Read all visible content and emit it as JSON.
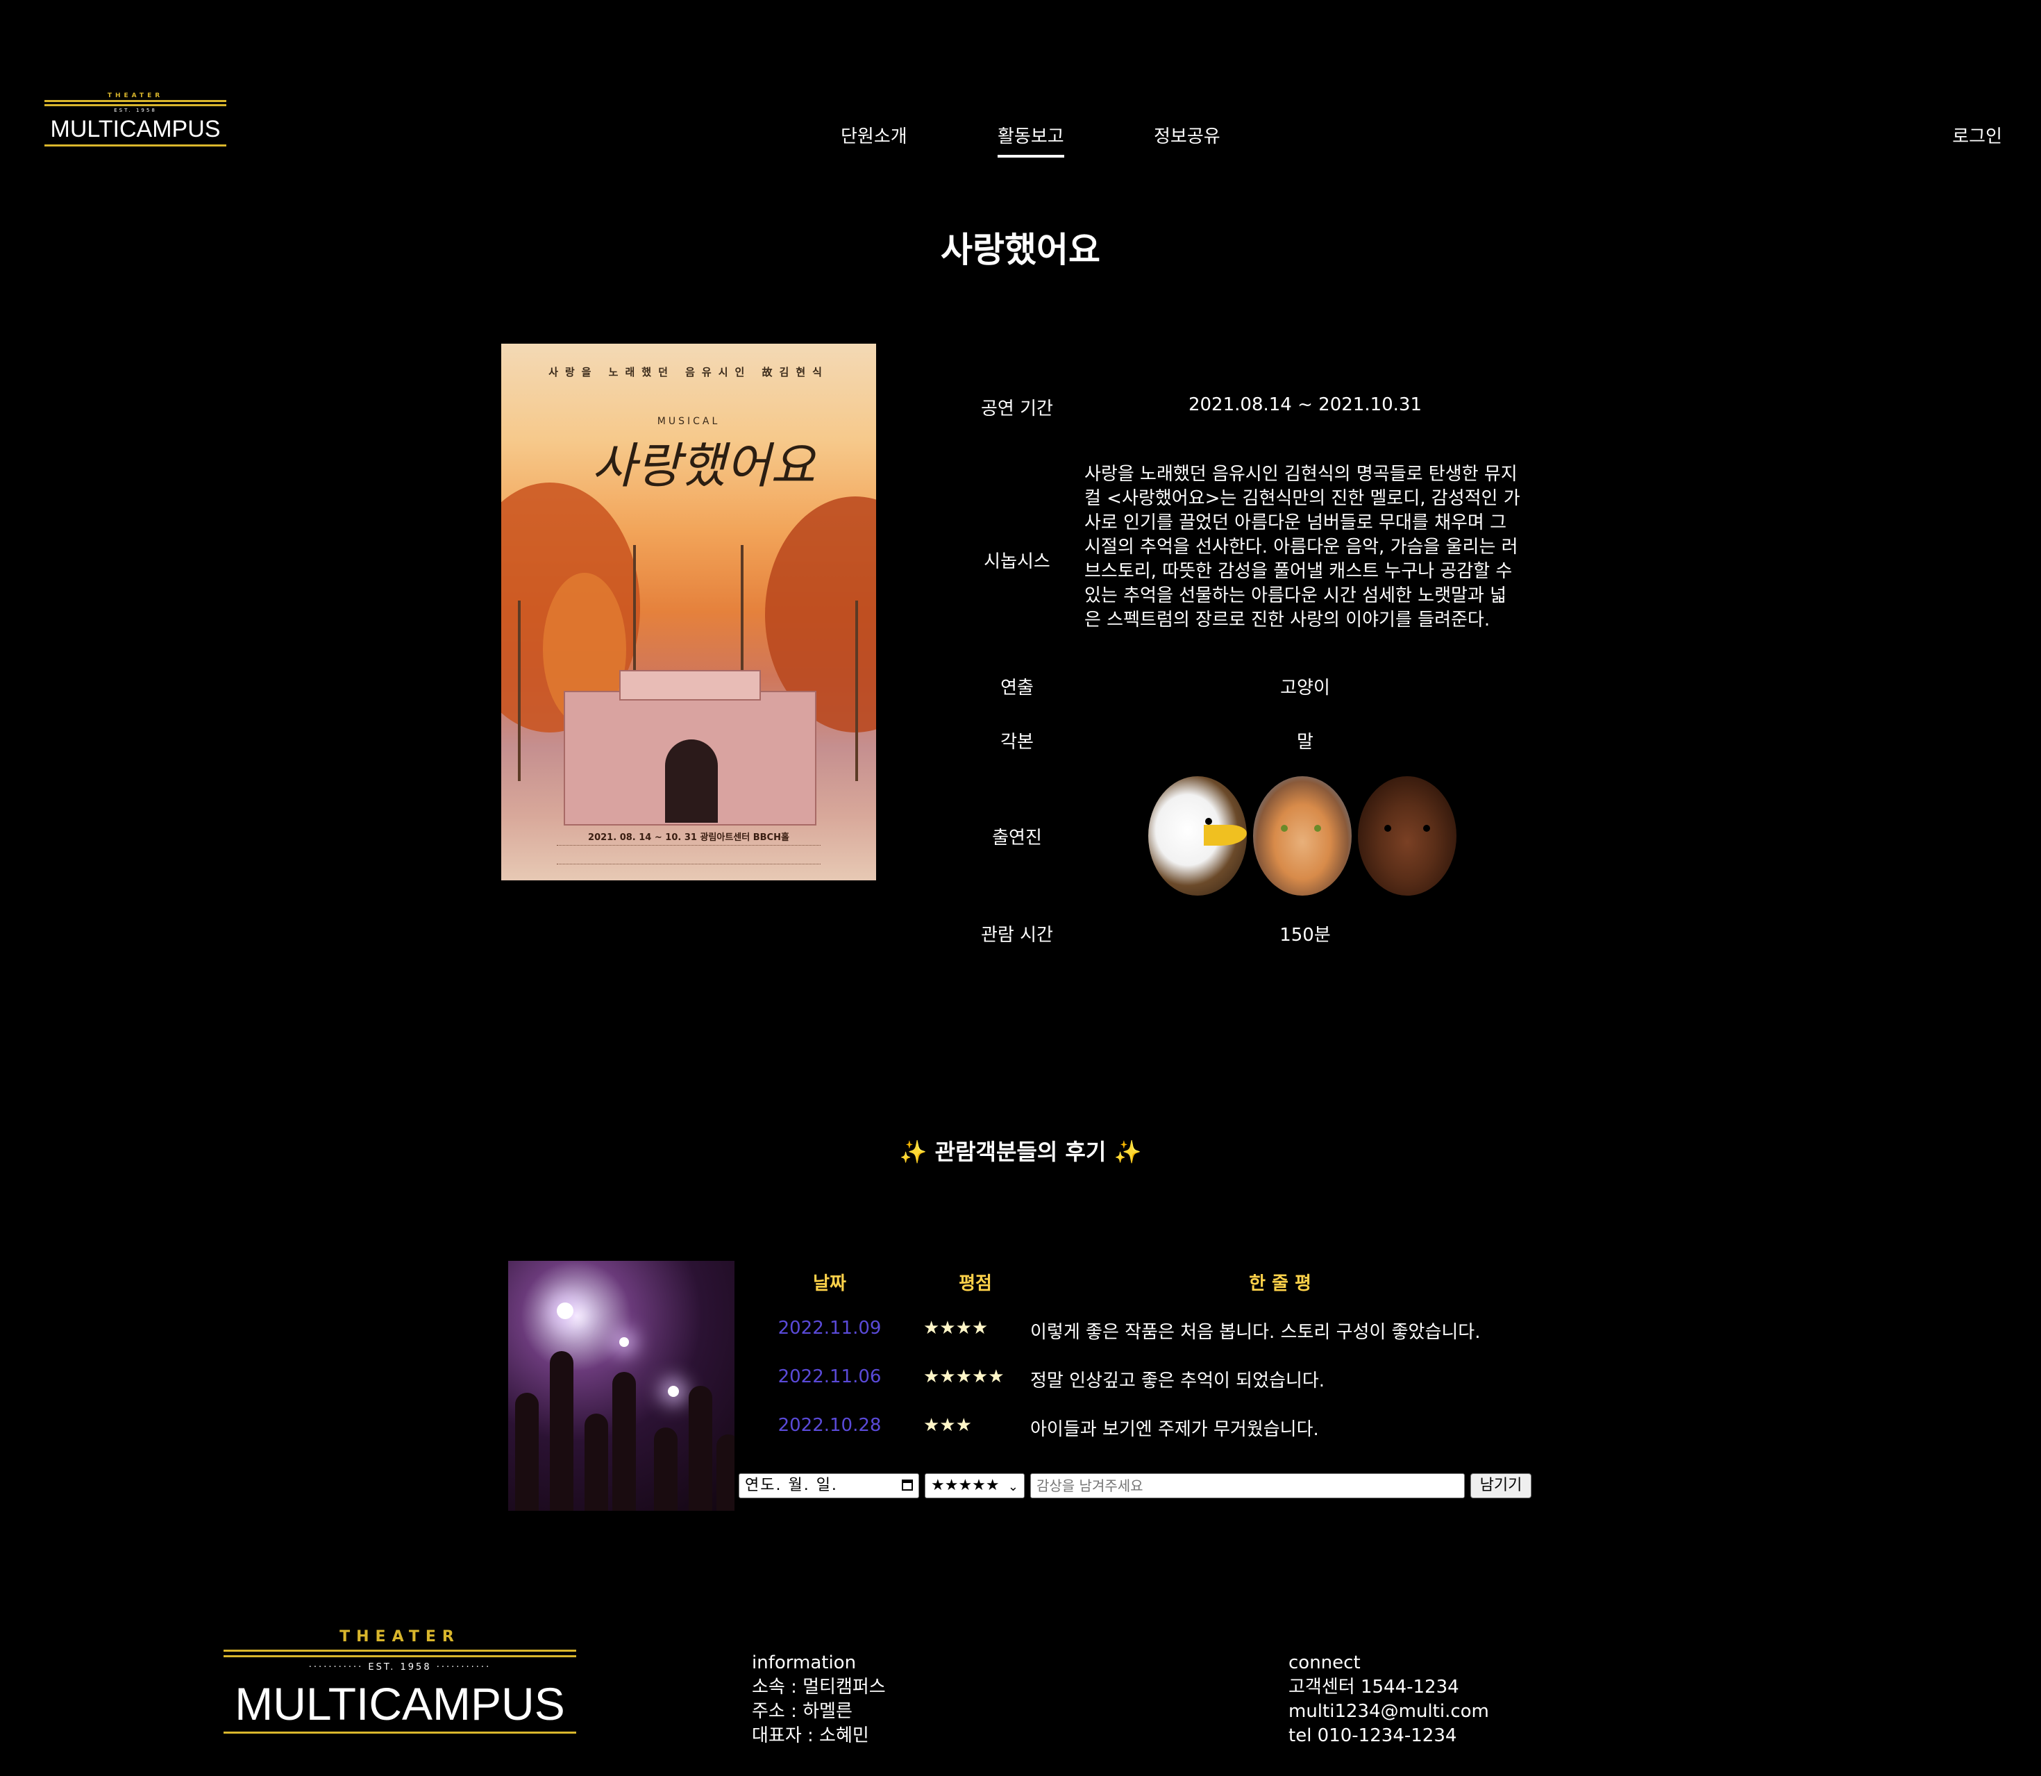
{
  "header": {
    "logo": {
      "theater": "THEATER",
      "est": "EST. 1958",
      "name": "MULTICAMPUS"
    },
    "nav": [
      {
        "label": "단원소개",
        "active": false
      },
      {
        "label": "활동보고",
        "active": true
      },
      {
        "label": "정보공유",
        "active": false
      }
    ],
    "login": "로그인"
  },
  "show": {
    "title": "사랑했어요",
    "poster": {
      "tagline": "사랑을 노래했던 음유시인 故김현식",
      "musical": "MUSICAL",
      "title": "사랑했어요",
      "dates": "2021. 08. 14 ~ 10. 31 광림아트센터 BBCH홀"
    },
    "details": {
      "period_label": "공연 기간",
      "period": "2021.08.14 ~ 2021.10.31",
      "synopsis_label": "시놉시스",
      "synopsis": "사랑을 노래했던 음유시인 김현식의 명곡들로 탄생한 뮤지컬 <사랑했어요>는 김현식만의 진한 멜로디, 감성적인 가사로 인기를 끌었던 아름다운 넘버들로 무대를 채우며 그 시절의 추억을 선사한다. 아름다운 음악, 가슴을 울리는 러브스토리, 따뜻한 감성을 풀어낼 캐스트 누구나 공감할 수 있는 추억을 선물하는 아름다운 시간 섬세한 노랫말과 넓은 스펙트럼의 장르로 진한 사랑의 이야기를 들려준다.",
      "director_label": "연출",
      "director": "고양이",
      "writer_label": "각본",
      "writer": "말",
      "cast_label": "출연진",
      "cast_icons": [
        "eagle-photo",
        "cat-photo",
        "cow-photo"
      ],
      "runtime_label": "관람 시간",
      "runtime": "150분"
    }
  },
  "reviews": {
    "heading": "✨ 관람객분들의 후기 ✨",
    "columns": {
      "date": "날짜",
      "rating": "평점",
      "comment": "한 줄 평"
    },
    "rows": [
      {
        "date": "2022.11.09",
        "stars": "★★★★",
        "text": "이렇게 좋은 작품은 처음 봅니다. 스토리 구성이 좋았습니다."
      },
      {
        "date": "2022.11.06",
        "stars": "★★★★★",
        "text": "정말 인상깊고 좋은 추억이 되었습니다."
      },
      {
        "date": "2022.10.28",
        "stars": "★★★",
        "text": "아이들과 보기엔 주제가 무거웠습니다."
      }
    ],
    "form": {
      "date_placeholder": "연도. 월. 일.",
      "rating_selected": "★★★★★",
      "comment_placeholder": "감상을 남겨주세요",
      "submit": "남기기"
    },
    "date_color": "#5a4ad8",
    "header_color": "#ffd24a"
  },
  "footer": {
    "logo": {
      "theater": "THEATER",
      "est": "EST. 1958",
      "name": "MULTICAMPUS"
    },
    "information": {
      "title": "information",
      "lines": [
        "소속 : 멀티캠퍼스",
        "주소 : 하멜른",
        "대표자 : 소혜민"
      ]
    },
    "connect": {
      "title": "connect",
      "lines": [
        "고객센터 1544-1234",
        "multi1234@multi.com",
        "tel 010-1234-1234"
      ]
    }
  },
  "colors": {
    "background": "#000000",
    "accent_gold": "#d9b62c"
  }
}
